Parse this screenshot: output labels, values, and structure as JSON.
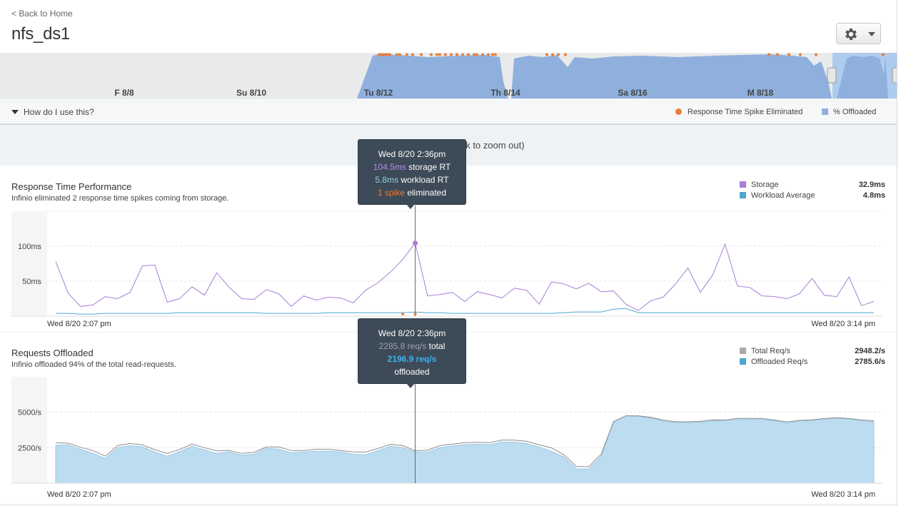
{
  "header": {
    "back_label": "< Back to Home",
    "title": "nfs_ds1",
    "settings_icon": "gear-icon",
    "dropdown_icon": "caret-down-icon"
  },
  "timeline": {
    "day_labels": [
      "F 8/8",
      "Su 8/10",
      "Tu 8/12",
      "Th 8/14",
      "Sa 8/16",
      "M 8/18"
    ],
    "offloaded_color": "#8fb0dc",
    "selection_color": "#aecbf0",
    "spike_color": "#e87e3b"
  },
  "help": {
    "label": "How do I use this?",
    "legend_spike": "Response Time Spike Eliminated",
    "legend_offloaded": "% Offloaded"
  },
  "zoom_note": "Showing ...(double-click to zoom out)",
  "rt_panel": {
    "title": "Response Time Performance",
    "subtitle": "Infinio eliminated 2 response time spikes coming from storage.",
    "legend": [
      {
        "name": "Storage",
        "value": "32.9ms",
        "color": "#a97ed6"
      },
      {
        "name": "Workload Average",
        "value": "4.8ms",
        "color": "#4aa8d0"
      }
    ],
    "tooltip": {
      "time": "Wed 8/20 2:36pm",
      "storage_value": "104.5ms",
      "storage_label": " storage RT",
      "workload_value": "5.8ms",
      "workload_label": " workload RT",
      "spike_value": "1 spike",
      "spike_label": " eliminated"
    }
  },
  "req_panel": {
    "title": "Requests Offloaded",
    "subtitle": "Infinio offloaded 94% of the total read-requests.",
    "legend": [
      {
        "name": "Total Req/s",
        "value": "2948.2/s",
        "color": "#aaaaaa"
      },
      {
        "name": "Offloaded Req/s",
        "value": "2785.6/s",
        "color": "#4aa8d0"
      }
    ],
    "tooltip": {
      "time": "Wed 8/20 2:36pm",
      "total_value": "2285.8 req/s",
      "total_label": " total",
      "offloaded_value": "2196.9 req/s",
      "offloaded_label": "offloaded"
    }
  },
  "chart_data": [
    {
      "type": "line",
      "title": "Response Time Performance",
      "x_start_label": "Wed 8/20 2:07 pm",
      "x_end_label": "Wed 8/20 3:14 pm",
      "y_ticks": [
        "100ms",
        "50ms"
      ],
      "y_tick_values": [
        100,
        50
      ],
      "ylim": [
        0,
        150
      ],
      "series": [
        {
          "name": "Storage",
          "color": "#a97ed6",
          "values": [
            78,
            33,
            14,
            16,
            28,
            25,
            34,
            72,
            73,
            20,
            25,
            42,
            30,
            62,
            41,
            25,
            24,
            38,
            32,
            14,
            29,
            23,
            27,
            26,
            19,
            37,
            48,
            63,
            81,
            104.5,
            29,
            31,
            34,
            21,
            35,
            31,
            26,
            40,
            37,
            17,
            49,
            46,
            39,
            47,
            35,
            36,
            17,
            8,
            22,
            27,
            46,
            69,
            34,
            59,
            103,
            43,
            41,
            29,
            28,
            25,
            32,
            54,
            30,
            28,
            56,
            15,
            21
          ]
        },
        {
          "name": "Workload Average",
          "color": "#4aa8d0",
          "values": [
            4,
            4,
            3,
            3,
            4,
            4,
            4,
            4,
            4,
            4,
            5,
            5,
            5,
            5,
            5,
            5,
            5,
            4,
            4,
            4,
            4,
            4,
            5,
            5,
            5,
            5,
            5,
            5,
            5,
            5.8,
            5,
            5,
            4,
            4,
            4,
            4,
            4,
            4,
            4,
            4,
            4,
            5,
            6,
            6,
            6,
            10,
            11,
            5,
            5,
            5,
            5,
            5,
            5,
            5,
            5,
            5,
            5,
            5,
            5,
            5,
            5,
            5,
            5,
            5,
            5,
            5,
            5
          ]
        }
      ],
      "spikes_eliminated_at": [
        28,
        29
      ]
    },
    {
      "type": "area",
      "title": "Requests Offloaded",
      "x_start_label": "Wed 8/20 2:07 pm",
      "x_end_label": "Wed 8/20 3:14 pm",
      "y_ticks": [
        "5000/s",
        "2500/s"
      ],
      "y_tick_values": [
        5000,
        2500
      ],
      "ylim": [
        0,
        7500
      ],
      "series": [
        {
          "name": "Total Req/s",
          "color": "#aaaaaa",
          "values": [
            2850,
            2820,
            2530,
            2300,
            1910,
            2650,
            2800,
            2700,
            2360,
            2100,
            2380,
            2750,
            2500,
            2280,
            2300,
            2100,
            2180,
            2550,
            2550,
            2300,
            2300,
            2390,
            2390,
            2300,
            2200,
            2190,
            2450,
            2740,
            2650,
            2285.8,
            2330,
            2650,
            2750,
            2860,
            2880,
            2860,
            3040,
            3040,
            2950,
            2700,
            2490,
            2000,
            1180,
            1160,
            2050,
            4350,
            4750,
            4750,
            4650,
            4450,
            4330,
            4330,
            4360,
            4460,
            4450,
            4570,
            4570,
            4560,
            4450,
            4320,
            4430,
            4470,
            4560,
            4620,
            4560,
            4460,
            4400
          ]
        },
        {
          "name": "Offloaded Req/s",
          "color": "#bcdcf0",
          "values": [
            2680,
            2700,
            2400,
            2100,
            1750,
            2500,
            2650,
            2560,
            2200,
            1900,
            2230,
            2600,
            2350,
            2100,
            2200,
            1980,
            2050,
            2450,
            2400,
            2150,
            2200,
            2250,
            2250,
            2200,
            2050,
            2000,
            2300,
            2600,
            2500,
            2196.9,
            2200,
            2500,
            2620,
            2720,
            2750,
            2720,
            2900,
            2900,
            2800,
            2550,
            2250,
            1850,
            1000,
            1000,
            1900,
            4300,
            4750,
            4700,
            4600,
            4400,
            4300,
            4300,
            4320,
            4400,
            4420,
            4500,
            4500,
            4500,
            4400,
            4250,
            4400,
            4420,
            4500,
            4580,
            4520,
            4400,
            4350
          ]
        }
      ]
    }
  ]
}
